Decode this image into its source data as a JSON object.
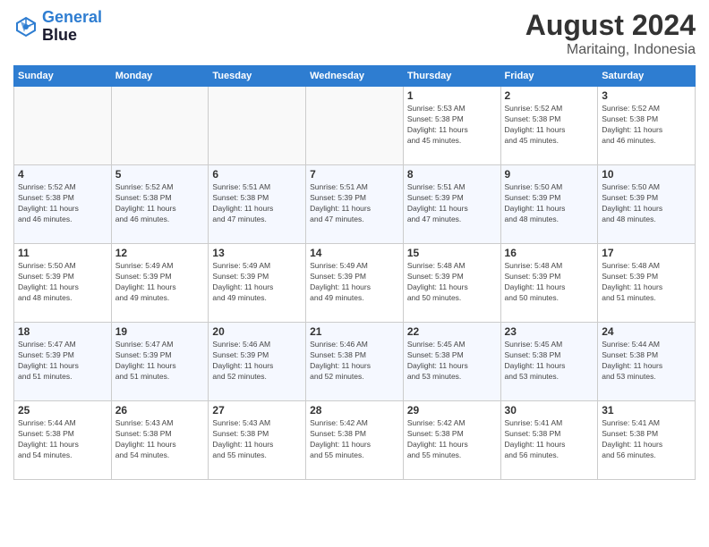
{
  "logo": {
    "line1": "General",
    "line2": "Blue"
  },
  "title": "August 2024",
  "subtitle": "Maritaing, Indonesia",
  "days_of_week": [
    "Sunday",
    "Monday",
    "Tuesday",
    "Wednesday",
    "Thursday",
    "Friday",
    "Saturday"
  ],
  "weeks": [
    [
      {
        "day": "",
        "info": ""
      },
      {
        "day": "",
        "info": ""
      },
      {
        "day": "",
        "info": ""
      },
      {
        "day": "",
        "info": ""
      },
      {
        "day": "1",
        "info": "Sunrise: 5:53 AM\nSunset: 5:38 PM\nDaylight: 11 hours\nand 45 minutes."
      },
      {
        "day": "2",
        "info": "Sunrise: 5:52 AM\nSunset: 5:38 PM\nDaylight: 11 hours\nand 45 minutes."
      },
      {
        "day": "3",
        "info": "Sunrise: 5:52 AM\nSunset: 5:38 PM\nDaylight: 11 hours\nand 46 minutes."
      }
    ],
    [
      {
        "day": "4",
        "info": "Sunrise: 5:52 AM\nSunset: 5:38 PM\nDaylight: 11 hours\nand 46 minutes."
      },
      {
        "day": "5",
        "info": "Sunrise: 5:52 AM\nSunset: 5:38 PM\nDaylight: 11 hours\nand 46 minutes."
      },
      {
        "day": "6",
        "info": "Sunrise: 5:51 AM\nSunset: 5:38 PM\nDaylight: 11 hours\nand 47 minutes."
      },
      {
        "day": "7",
        "info": "Sunrise: 5:51 AM\nSunset: 5:39 PM\nDaylight: 11 hours\nand 47 minutes."
      },
      {
        "day": "8",
        "info": "Sunrise: 5:51 AM\nSunset: 5:39 PM\nDaylight: 11 hours\nand 47 minutes."
      },
      {
        "day": "9",
        "info": "Sunrise: 5:50 AM\nSunset: 5:39 PM\nDaylight: 11 hours\nand 48 minutes."
      },
      {
        "day": "10",
        "info": "Sunrise: 5:50 AM\nSunset: 5:39 PM\nDaylight: 11 hours\nand 48 minutes."
      }
    ],
    [
      {
        "day": "11",
        "info": "Sunrise: 5:50 AM\nSunset: 5:39 PM\nDaylight: 11 hours\nand 48 minutes."
      },
      {
        "day": "12",
        "info": "Sunrise: 5:49 AM\nSunset: 5:39 PM\nDaylight: 11 hours\nand 49 minutes."
      },
      {
        "day": "13",
        "info": "Sunrise: 5:49 AM\nSunset: 5:39 PM\nDaylight: 11 hours\nand 49 minutes."
      },
      {
        "day": "14",
        "info": "Sunrise: 5:49 AM\nSunset: 5:39 PM\nDaylight: 11 hours\nand 49 minutes."
      },
      {
        "day": "15",
        "info": "Sunrise: 5:48 AM\nSunset: 5:39 PM\nDaylight: 11 hours\nand 50 minutes."
      },
      {
        "day": "16",
        "info": "Sunrise: 5:48 AM\nSunset: 5:39 PM\nDaylight: 11 hours\nand 50 minutes."
      },
      {
        "day": "17",
        "info": "Sunrise: 5:48 AM\nSunset: 5:39 PM\nDaylight: 11 hours\nand 51 minutes."
      }
    ],
    [
      {
        "day": "18",
        "info": "Sunrise: 5:47 AM\nSunset: 5:39 PM\nDaylight: 11 hours\nand 51 minutes."
      },
      {
        "day": "19",
        "info": "Sunrise: 5:47 AM\nSunset: 5:39 PM\nDaylight: 11 hours\nand 51 minutes."
      },
      {
        "day": "20",
        "info": "Sunrise: 5:46 AM\nSunset: 5:39 PM\nDaylight: 11 hours\nand 52 minutes."
      },
      {
        "day": "21",
        "info": "Sunrise: 5:46 AM\nSunset: 5:38 PM\nDaylight: 11 hours\nand 52 minutes."
      },
      {
        "day": "22",
        "info": "Sunrise: 5:45 AM\nSunset: 5:38 PM\nDaylight: 11 hours\nand 53 minutes."
      },
      {
        "day": "23",
        "info": "Sunrise: 5:45 AM\nSunset: 5:38 PM\nDaylight: 11 hours\nand 53 minutes."
      },
      {
        "day": "24",
        "info": "Sunrise: 5:44 AM\nSunset: 5:38 PM\nDaylight: 11 hours\nand 53 minutes."
      }
    ],
    [
      {
        "day": "25",
        "info": "Sunrise: 5:44 AM\nSunset: 5:38 PM\nDaylight: 11 hours\nand 54 minutes."
      },
      {
        "day": "26",
        "info": "Sunrise: 5:43 AM\nSunset: 5:38 PM\nDaylight: 11 hours\nand 54 minutes."
      },
      {
        "day": "27",
        "info": "Sunrise: 5:43 AM\nSunset: 5:38 PM\nDaylight: 11 hours\nand 55 minutes."
      },
      {
        "day": "28",
        "info": "Sunrise: 5:42 AM\nSunset: 5:38 PM\nDaylight: 11 hours\nand 55 minutes."
      },
      {
        "day": "29",
        "info": "Sunrise: 5:42 AM\nSunset: 5:38 PM\nDaylight: 11 hours\nand 55 minutes."
      },
      {
        "day": "30",
        "info": "Sunrise: 5:41 AM\nSunset: 5:38 PM\nDaylight: 11 hours\nand 56 minutes."
      },
      {
        "day": "31",
        "info": "Sunrise: 5:41 AM\nSunset: 5:38 PM\nDaylight: 11 hours\nand 56 minutes."
      }
    ]
  ]
}
